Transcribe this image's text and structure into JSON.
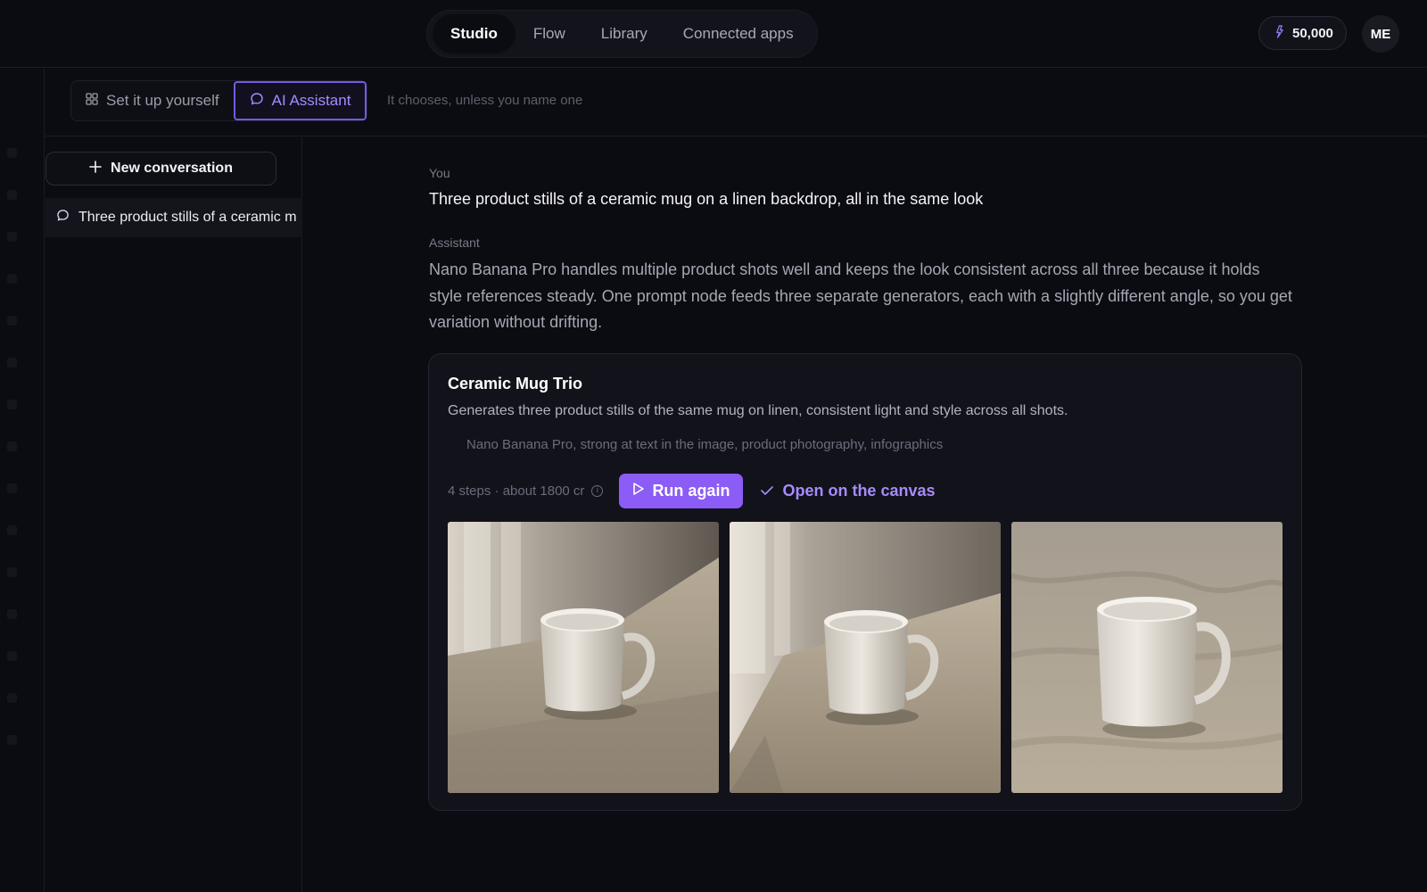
{
  "nav": {
    "tabs": [
      {
        "label": "Studio"
      },
      {
        "label": "Flow"
      },
      {
        "label": "Library"
      },
      {
        "label": "Connected apps"
      }
    ],
    "active_tab": "Studio"
  },
  "account": {
    "credits": "50,000",
    "avatar_initials": "ME"
  },
  "mode": {
    "manual_label": "Set it up yourself",
    "assistant_label": "AI Assistant",
    "hint": "It chooses, unless you name one"
  },
  "sidebar": {
    "new_conversation_label": "New conversation",
    "conversations": [
      {
        "title": "Three product stills of a ceramic m"
      }
    ]
  },
  "chat": {
    "user_role": "You",
    "user_message": "Three product stills of a ceramic mug on a linen backdrop, all in the same look",
    "assistant_role": "Assistant",
    "assistant_message": "Nano Banana Pro handles multiple product shots well and keeps the look consistent across all three because it holds style references steady. One prompt node feeds three separate generators, each with a slightly different angle, so you get variation without drifting."
  },
  "card": {
    "title": "Ceramic Mug Trio",
    "description": "Generates three product stills of the same mug on linen, consistent light and style across all shots.",
    "model_info": "Nano Banana Pro, strong at text in the image, product photography, infographics",
    "steps": "4 steps · about 1800 cr",
    "run_label": "Run again",
    "open_label": "Open on the canvas"
  },
  "colors": {
    "accent": "#8b5cf6",
    "accent_text": "#a78bfa",
    "background": "#0b0b12"
  }
}
